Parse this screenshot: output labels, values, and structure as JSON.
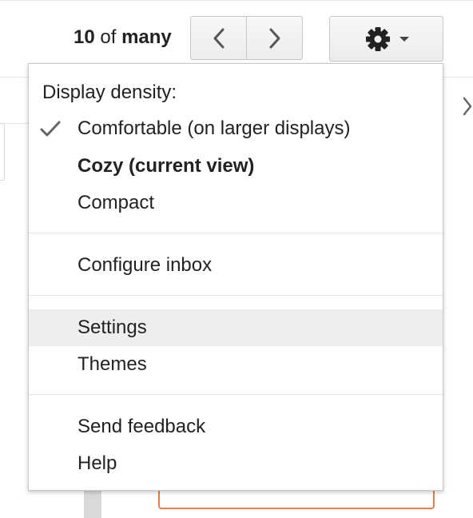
{
  "pager": {
    "current": "10",
    "separator": "of",
    "total": "many"
  },
  "toolbar": {
    "prev_icon": "chevron-left-icon",
    "next_icon": "chevron-right-icon",
    "settings_icon": "gear-icon",
    "dropdown_icon": "caret-down-icon"
  },
  "menu": {
    "density_heading": "Display density:",
    "density_options": [
      {
        "label": "Comfortable (on larger displays)",
        "checked": true,
        "current": false
      },
      {
        "label": "Cozy (current view)",
        "checked": false,
        "current": true
      },
      {
        "label": "Compact",
        "checked": false,
        "current": false
      }
    ],
    "configure_inbox": "Configure inbox",
    "settings": "Settings",
    "themes": "Themes",
    "send_feedback": "Send feedback",
    "help": "Help",
    "highlighted_item": "Settings"
  },
  "colors": {
    "accent_orange": "#e67e52",
    "hover_bg": "#eeeeee",
    "text": "#222222"
  }
}
